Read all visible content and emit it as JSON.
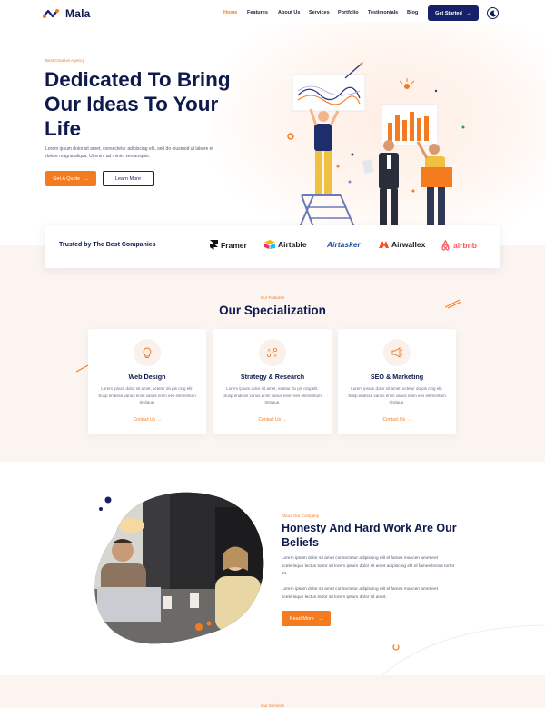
{
  "brand": {
    "name": "Mala",
    "accent": "#f47b20",
    "navy": "#16216a"
  },
  "nav": {
    "items": [
      {
        "label": "Home",
        "active": true
      },
      {
        "label": "Features"
      },
      {
        "label": "About Us"
      },
      {
        "label": "Services"
      },
      {
        "label": "Portfolio"
      },
      {
        "label": "Testimonials"
      },
      {
        "label": "Blog"
      }
    ],
    "cta": "Get Started",
    "cta_icon": "arrow-right-icon",
    "theme_icon": "moon-icon"
  },
  "hero": {
    "tag": "Best Creative Agency",
    "title": "Dedicated To Bring Our Ideas To Your Life",
    "description": "Lorem ipsum dolor sit amet, consectetur adipiscing elit, sed do eiusmod ut labore et dolore magna aliqua. Ut enim ad minim veniamquis.",
    "primary_button": "Get A Quote",
    "secondary_button": "Learn More"
  },
  "trusted": {
    "title": "Trusted by The Best Companies",
    "logos": [
      {
        "name": "Framer",
        "icon": "framer-icon"
      },
      {
        "name": "Airtable",
        "icon": "airtable-icon"
      },
      {
        "name": "Airtasker",
        "icon": "airtasker-icon"
      },
      {
        "name": "Airwallex",
        "icon": "airwallex-icon"
      },
      {
        "name": "airbnb",
        "icon": "airbnb-icon"
      }
    ]
  },
  "features": {
    "tag": "Our Features",
    "title": "Our Specialization",
    "cards": [
      {
        "title": "Web Design",
        "icon": "lightbulb-icon",
        "desc": "Lorem ipsum dolor sit amet, ectetur do pis cing elit. Susp endisse varius enim varius enim ees elementum tristique.",
        "link": "Contact Us"
      },
      {
        "title": "Strategy & Research",
        "icon": "strategy-icon",
        "desc": "Lorem ipsum dolor sit amet, ectetur do pis cing elit. Susp endisse varius enim varius enim ees elementum tristique.",
        "link": "Contact Us"
      },
      {
        "title": "SEO & Marketing",
        "icon": "megaphone-icon",
        "desc": "Lorem ipsum dolor sit amet, ectetur do pis cing elit. Susp endisse varius enim varius enim ees elementum tristique.",
        "link": "Contact Us"
      }
    ]
  },
  "about": {
    "tag": "About Our Company",
    "title": "Honesty And Hard Work Are Our Beliefs",
    "p1": "Lorem ipsum dolor sit amet consectetur adipiscing elit el fames maecen amet eet scelerisque lectus tortor sit lorem ipsum dolor sit amet adipiscing elit el fames lectus tortor sit.",
    "p2": "Lorem ipsum dolor sit amet consectetur adipiscing elit el fames maecen amet eet scelerisque lectus tortor sit lorem ipsum dolor sit amet.",
    "button": "Read More"
  },
  "services": {
    "tag": "Our Services"
  }
}
